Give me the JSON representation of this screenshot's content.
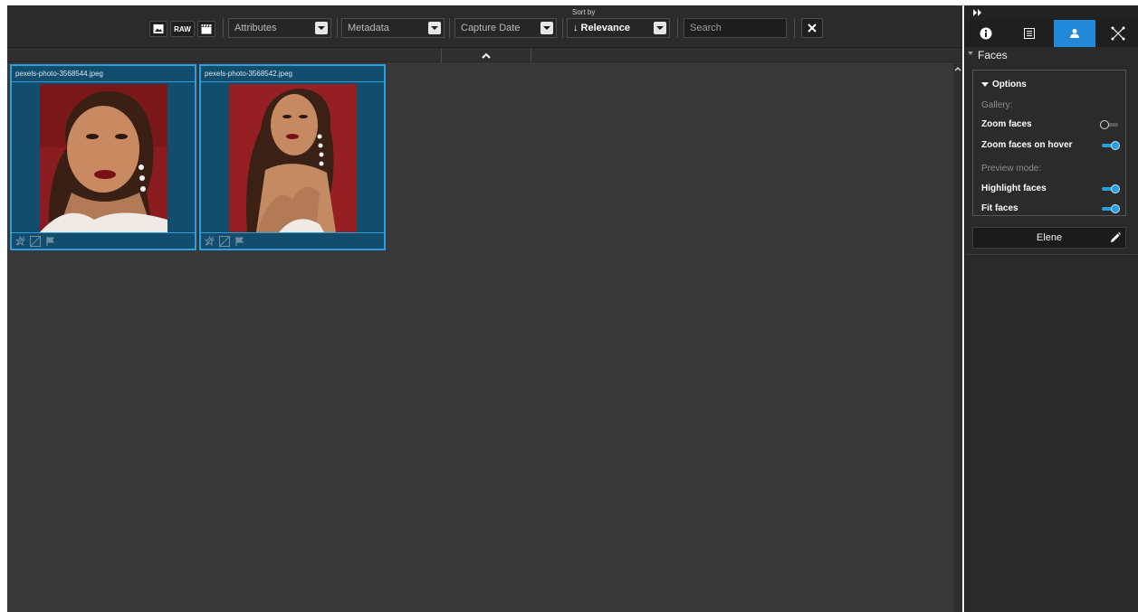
{
  "colors": {
    "accent": "#2b9ee0",
    "selection": "#124d6e",
    "main_bg": "#383838",
    "toolbar_bg": "#2b2b2b",
    "panel_bg": "#2a2a2a"
  },
  "toolbar": {
    "type_filters": [
      {
        "name": "image-icon"
      },
      {
        "label": "RAW"
      },
      {
        "name": "video-clapper-icon"
      }
    ],
    "attributes_label": "Attributes",
    "metadata_label": "Metadata",
    "capture_date_label": "Capture Date",
    "sort_by_label": "Sort by",
    "sort_value": "↓ Relevance",
    "search_placeholder": "Search",
    "clear_icon": "close-icon"
  },
  "collapse_icon": "chevron-up-icon",
  "grid": {
    "items": [
      {
        "filename": "pexels-photo-3568544.jpeg",
        "footer_icons": [
          "unrated-star-icon",
          "label-icon",
          "flag-icon"
        ]
      },
      {
        "filename": "pexels-photo-3568542.jpeg",
        "footer_icons": [
          "unrated-star-icon",
          "label-icon",
          "flag-icon"
        ]
      }
    ]
  },
  "right_panel": {
    "collapse_icon": "double-chevron-right-icon",
    "tabs": [
      {
        "name": "info-icon",
        "active": false
      },
      {
        "name": "metadata-list-icon",
        "active": false
      },
      {
        "name": "person-icon",
        "active": true
      },
      {
        "name": "geo-network-icon",
        "active": false
      }
    ],
    "section_title": "Faces",
    "options": {
      "title": "Options",
      "gallery_label": "Gallery:",
      "zoom_faces_label": "Zoom faces",
      "zoom_faces_on": false,
      "zoom_hover_label": "Zoom faces on hover",
      "zoom_hover_on": true,
      "preview_mode_label": "Preview mode:",
      "highlight_label": "Highlight faces",
      "highlight_on": true,
      "fit_label": "Fit faces",
      "fit_on": true
    },
    "person_name": "Elene"
  }
}
